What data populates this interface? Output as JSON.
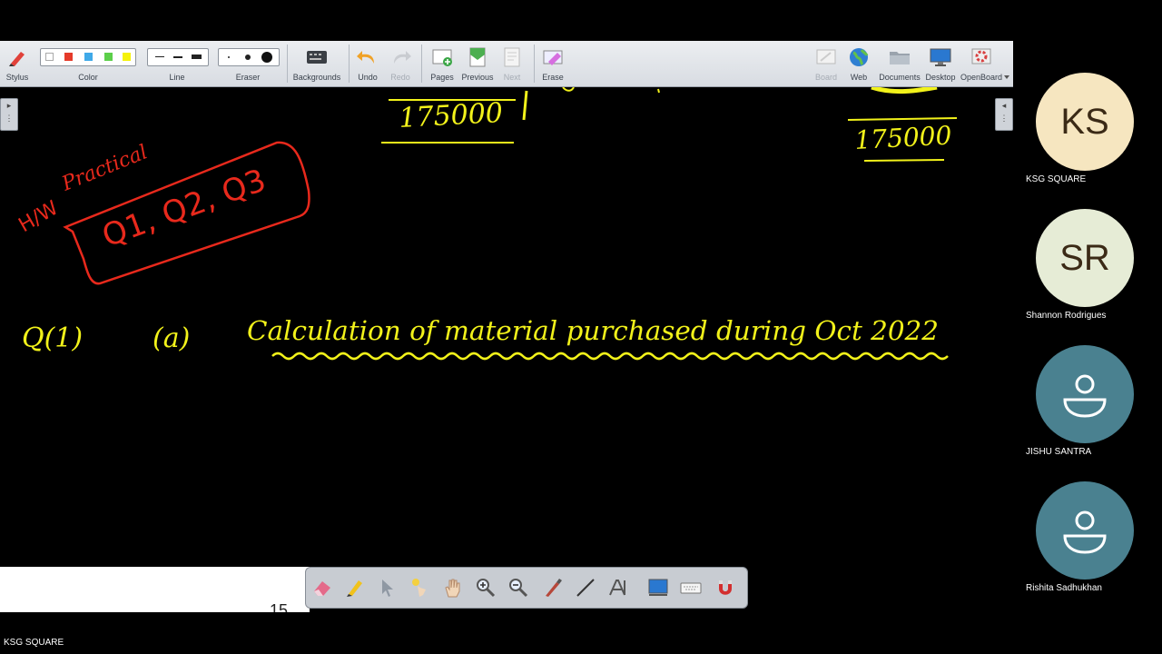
{
  "toolbar": {
    "stylus": "Stylus",
    "color": "Color",
    "line": "Line",
    "eraser": "Eraser",
    "backgrounds": "Backgrounds",
    "undo": "Undo",
    "redo": "Redo",
    "pages": "Pages",
    "previous": "Previous",
    "next": "Next",
    "erase": "Erase",
    "board": "Board",
    "web": "Web",
    "documents": "Documents",
    "desktop": "Desktop",
    "openboard": "OpenBoard",
    "colors": [
      "#ffffff",
      "#e53a2a",
      "#3fa9e8",
      "#5ccf4a",
      "#f5f20a"
    ]
  },
  "board": {
    "amount_left": "175000",
    "amount_right": "175000",
    "hw_label": "H/W",
    "practical_label": "Practical",
    "homework_questions": "Q1, Q2, Q3",
    "question_number": "Q(1)",
    "part": "(a)",
    "heading": "Calculation of material purchased during Oct 2022",
    "ink_colors": {
      "yellow": "#f2f21a",
      "red": "#e8291c"
    }
  },
  "bottom": {
    "page_number": "15",
    "tools": [
      "eraser-icon",
      "pen-icon",
      "pointer-icon",
      "laser-icon",
      "hand-icon",
      "zoom-in-icon",
      "zoom-out-icon",
      "marker-icon",
      "line-icon",
      "text-icon",
      "capture-icon",
      "keyboard-icon",
      "magnet-icon"
    ]
  },
  "participants": [
    {
      "initials": "KS",
      "name": "KSG SQUARE",
      "color": "#f6e6c0"
    },
    {
      "initials": "SR",
      "name": "Shannon  Rodrigues",
      "color": "#e6ecd6"
    },
    {
      "initials": "",
      "name": "JISHU SANTRA",
      "color": "#4a8190"
    },
    {
      "initials": "",
      "name": "Rishita Sadhukhan",
      "color": "#4a8190"
    }
  ],
  "footer": {
    "presenter": "KSG SQUARE"
  }
}
